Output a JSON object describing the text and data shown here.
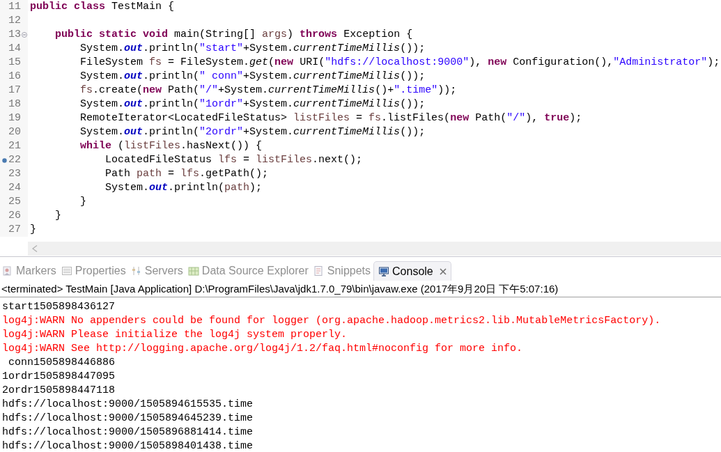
{
  "editor": {
    "lines": [
      {
        "number": "11",
        "foldable": false,
        "marked": false,
        "tokens": [
          {
            "kind": "keyword",
            "text": "public class"
          },
          {
            "kind": "plain",
            "text": " TestMain {"
          }
        ]
      },
      {
        "number": "12",
        "foldable": false,
        "marked": false
      },
      {
        "number": "13",
        "foldable": true,
        "marked": false,
        "tokens": [
          {
            "kind": "keyword",
            "text": "    public static void"
          },
          {
            "kind": "plain",
            "text": " main(String[] "
          },
          {
            "kind": "variable",
            "text": "args"
          },
          {
            "kind": "plain",
            "text": ") "
          },
          {
            "kind": "keyword",
            "text": "throws"
          },
          {
            "kind": "plain",
            "text": " Exception {"
          }
        ]
      },
      {
        "number": "14",
        "foldable": false,
        "marked": false,
        "tokens": [
          {
            "kind": "plain",
            "text": "        System."
          },
          {
            "kind": "field",
            "text": "out"
          },
          {
            "kind": "plain",
            "text": ".println("
          },
          {
            "kind": "string",
            "text": "\"start\""
          },
          {
            "kind": "plain",
            "text": "+System."
          },
          {
            "kind": "static",
            "text": "currentTimeMillis"
          },
          {
            "kind": "plain",
            "text": "());"
          }
        ]
      },
      {
        "number": "15",
        "foldable": false,
        "marked": false,
        "tokens": [
          {
            "kind": "plain",
            "text": "        FileSystem "
          },
          {
            "kind": "variable",
            "text": "fs"
          },
          {
            "kind": "plain",
            "text": " = FileSystem."
          },
          {
            "kind": "static",
            "text": "get"
          },
          {
            "kind": "plain",
            "text": "("
          },
          {
            "kind": "keyword",
            "text": "new"
          },
          {
            "kind": "plain",
            "text": " URI("
          },
          {
            "kind": "string",
            "text": "\"hdfs://localhost:9000\""
          },
          {
            "kind": "plain",
            "text": "), "
          },
          {
            "kind": "keyword",
            "text": "new"
          },
          {
            "kind": "plain",
            "text": " Configuration(),"
          },
          {
            "kind": "string",
            "text": "\"Administrator\""
          },
          {
            "kind": "plain",
            "text": ");"
          }
        ]
      },
      {
        "number": "16",
        "foldable": false,
        "marked": false,
        "tokens": [
          {
            "kind": "plain",
            "text": "        System."
          },
          {
            "kind": "field",
            "text": "out"
          },
          {
            "kind": "plain",
            "text": ".println("
          },
          {
            "kind": "string",
            "text": "\" conn\""
          },
          {
            "kind": "plain",
            "text": "+System."
          },
          {
            "kind": "static",
            "text": "currentTimeMillis"
          },
          {
            "kind": "plain",
            "text": "());"
          }
        ]
      },
      {
        "number": "17",
        "foldable": false,
        "marked": false,
        "tokens": [
          {
            "kind": "variable",
            "text": "        fs"
          },
          {
            "kind": "plain",
            "text": ".create("
          },
          {
            "kind": "keyword",
            "text": "new"
          },
          {
            "kind": "plain",
            "text": " Path("
          },
          {
            "kind": "string",
            "text": "\"/\""
          },
          {
            "kind": "plain",
            "text": "+System."
          },
          {
            "kind": "static",
            "text": "currentTimeMillis"
          },
          {
            "kind": "plain",
            "text": "()+"
          },
          {
            "kind": "string",
            "text": "\".time\""
          },
          {
            "kind": "plain",
            "text": "));"
          }
        ]
      },
      {
        "number": "18",
        "foldable": false,
        "marked": false,
        "tokens": [
          {
            "kind": "plain",
            "text": "        System."
          },
          {
            "kind": "field",
            "text": "out"
          },
          {
            "kind": "plain",
            "text": ".println("
          },
          {
            "kind": "string",
            "text": "\"1ordr\""
          },
          {
            "kind": "plain",
            "text": "+System."
          },
          {
            "kind": "static",
            "text": "currentTimeMillis"
          },
          {
            "kind": "plain",
            "text": "());"
          }
        ]
      },
      {
        "number": "19",
        "foldable": false,
        "marked": false,
        "tokens": [
          {
            "kind": "plain",
            "text": "        RemoteIterator<LocatedFileStatus> "
          },
          {
            "kind": "variable",
            "text": "listFiles"
          },
          {
            "kind": "plain",
            "text": " = "
          },
          {
            "kind": "variable",
            "text": "fs"
          },
          {
            "kind": "plain",
            "text": ".listFiles("
          },
          {
            "kind": "keyword",
            "text": "new"
          },
          {
            "kind": "plain",
            "text": " Path("
          },
          {
            "kind": "string",
            "text": "\"/\""
          },
          {
            "kind": "plain",
            "text": "), "
          },
          {
            "kind": "keyword",
            "text": "true"
          },
          {
            "kind": "plain",
            "text": ");"
          }
        ]
      },
      {
        "number": "20",
        "foldable": false,
        "marked": false,
        "tokens": [
          {
            "kind": "plain",
            "text": "        System."
          },
          {
            "kind": "field",
            "text": "out"
          },
          {
            "kind": "plain",
            "text": ".println("
          },
          {
            "kind": "string",
            "text": "\"2ordr\""
          },
          {
            "kind": "plain",
            "text": "+System."
          },
          {
            "kind": "static",
            "text": "currentTimeMillis"
          },
          {
            "kind": "plain",
            "text": "());"
          }
        ]
      },
      {
        "number": "21",
        "foldable": false,
        "marked": false,
        "tokens": [
          {
            "kind": "keyword",
            "text": "        while"
          },
          {
            "kind": "plain",
            "text": " ("
          },
          {
            "kind": "variable",
            "text": "listFiles"
          },
          {
            "kind": "plain",
            "text": ".hasNext()) {"
          }
        ]
      },
      {
        "number": "22",
        "foldable": false,
        "marked": true,
        "tokens": [
          {
            "kind": "plain",
            "text": "            LocatedFileStatus "
          },
          {
            "kind": "variable",
            "text": "lfs"
          },
          {
            "kind": "plain",
            "text": " = "
          },
          {
            "kind": "variable",
            "text": "listFiles"
          },
          {
            "kind": "plain",
            "text": ".next();"
          }
        ]
      },
      {
        "number": "23",
        "foldable": false,
        "marked": false,
        "tokens": [
          {
            "kind": "plain",
            "text": "            Path "
          },
          {
            "kind": "variable",
            "text": "path"
          },
          {
            "kind": "plain",
            "text": " = "
          },
          {
            "kind": "variable",
            "text": "lfs"
          },
          {
            "kind": "plain",
            "text": ".getPath();"
          }
        ]
      },
      {
        "number": "24",
        "foldable": false,
        "marked": false,
        "tokens": [
          {
            "kind": "plain",
            "text": "            System."
          },
          {
            "kind": "field",
            "text": "out"
          },
          {
            "kind": "plain",
            "text": ".println("
          },
          {
            "kind": "variable",
            "text": "path"
          },
          {
            "kind": "plain",
            "text": ");"
          }
        ]
      },
      {
        "number": "25",
        "foldable": false,
        "marked": false,
        "tokens": [
          {
            "kind": "plain",
            "text": "        }"
          }
        ]
      },
      {
        "number": "26",
        "foldable": false,
        "marked": false,
        "tokens": [
          {
            "kind": "plain",
            "text": "    }"
          }
        ]
      },
      {
        "number": "27",
        "foldable": false,
        "marked": false,
        "tokens": [
          {
            "kind": "plain",
            "text": "}"
          }
        ]
      }
    ]
  },
  "tabs": [
    {
      "kind": "markers",
      "label": "Markers",
      "selected": false
    },
    {
      "kind": "properties",
      "label": "Properties",
      "selected": false
    },
    {
      "kind": "servers",
      "label": "Servers",
      "selected": false
    },
    {
      "kind": "datasource",
      "label": "Data Source Explorer",
      "selected": false
    },
    {
      "kind": "snippets",
      "label": "Snippets",
      "selected": false
    },
    {
      "kind": "console",
      "label": "Console",
      "selected": true
    }
  ],
  "console": {
    "header": "<terminated> TestMain [Java Application] D:\\ProgramFiles\\Java\\jdk1.7.0_79\\bin\\javaw.exe (2017年9月20日 下午5:07:16)",
    "lines": [
      {
        "kind": "stdout",
        "text": "start1505898436127"
      },
      {
        "kind": "stderr",
        "text": "log4j:WARN No appenders could be found for logger (org.apache.hadoop.metrics2.lib.MutableMetricsFactory)."
      },
      {
        "kind": "stderr",
        "text": "log4j:WARN Please initialize the log4j system properly."
      },
      {
        "kind": "stderr",
        "text": "log4j:WARN See http://logging.apache.org/log4j/1.2/faq.html#noconfig for more info."
      },
      {
        "kind": "stdout",
        "text": " conn1505898446886"
      },
      {
        "kind": "stdout",
        "text": "1ordr1505898447095"
      },
      {
        "kind": "stdout",
        "text": "2ordr1505898447118"
      },
      {
        "kind": "stdout",
        "text": "hdfs://localhost:9000/1505894615535.time"
      },
      {
        "kind": "stdout",
        "text": "hdfs://localhost:9000/1505894645239.time"
      },
      {
        "kind": "stdout",
        "text": "hdfs://localhost:9000/1505896881414.time"
      },
      {
        "kind": "stdout",
        "text": "hdfs://localhost:9000/1505898401438.time"
      }
    ]
  }
}
